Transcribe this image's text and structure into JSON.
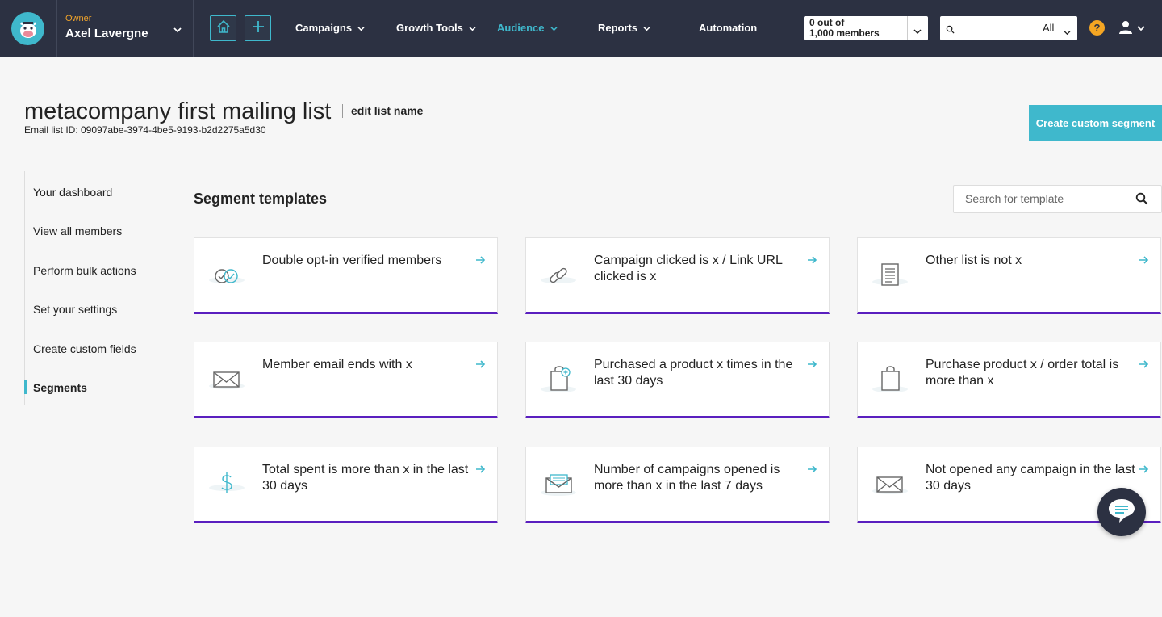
{
  "colors": {
    "nav_bg": "#2c3142",
    "accent": "#3fb8cc",
    "card_border": "#5a1fbf",
    "owner_label": "#f0a32a",
    "help": "#f5a623"
  },
  "topnav": {
    "owner_role": "Owner",
    "owner_name": "Axel Lavergne",
    "menu": [
      {
        "label": "Campaigns",
        "active": false
      },
      {
        "label": "Growth Tools",
        "active": false
      },
      {
        "label": "Audience",
        "active": true
      },
      {
        "label": "Reports",
        "active": false
      },
      {
        "label": "Automation",
        "active": false
      }
    ],
    "members_line1": "0 out of",
    "members_line2": "1,000 members",
    "search_scope": "All",
    "help_label": "?"
  },
  "header": {
    "list_title": "metacompany first mailing list",
    "edit_label": "edit list name",
    "list_id": "Email list ID: 09097abe-3974-4be5-9193-b2d2275a5d30",
    "create_button": "Create custom segment"
  },
  "sidebar": {
    "items": [
      {
        "label": "Your dashboard"
      },
      {
        "label": "View all members"
      },
      {
        "label": "Perform bulk actions"
      },
      {
        "label": "Set your settings"
      },
      {
        "label": "Create custom fields"
      },
      {
        "label": "Segments"
      }
    ]
  },
  "main": {
    "heading": "Segment templates",
    "search_placeholder": "Search for template",
    "templates": [
      {
        "label": "Double opt-in verified members",
        "icon": "double-check-icon"
      },
      {
        "label": "Campaign clicked is x / Link URL clicked is x",
        "icon": "link-icon"
      },
      {
        "label": "Other list is not x",
        "icon": "list-document-icon"
      },
      {
        "label": "Member email ends with x",
        "icon": "envelope-icon"
      },
      {
        "label": "Purchased a product x times in the last 30 days",
        "icon": "shopping-bag-plus-icon"
      },
      {
        "label": "Purchase product x / order total is more than x",
        "icon": "shopping-bag-icon"
      },
      {
        "label": "Total spent is more than x in the last 30 days",
        "icon": "dollar-icon"
      },
      {
        "label": "Number of campaigns opened is more than x in the last 7 days",
        "icon": "open-envelope-icon"
      },
      {
        "label": "Not opened any campaign in the last 30 days",
        "icon": "envelope-icon"
      }
    ]
  }
}
